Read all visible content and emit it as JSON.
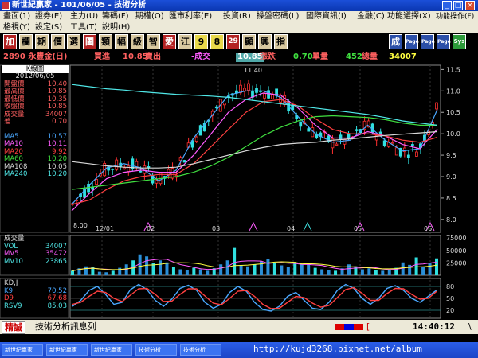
{
  "window": {
    "title": "新世紀贏家 - 101/06/05 - 技術分析"
  },
  "menu": {
    "row1": [
      "畫面(1)",
      "證券(E)",
      "主力(U)",
      "籌碼(F)",
      "期權(O)",
      "匯市利率(E)",
      "投資(R)",
      "操盤密碼(L)",
      "國際資訊(I)",
      "金融(C)",
      "功能選擇(X)",
      "功能操作(F)"
    ],
    "row2": [
      "格視(Y)",
      "設定(S)",
      "工具(T)",
      "說明(H)"
    ]
  },
  "toolbar": {
    "buttons": [
      "加",
      "欄",
      "期",
      "價",
      "選",
      "圖",
      "類",
      "幅",
      "級",
      "智",
      "愛",
      "江",
      "9",
      "8",
      "29",
      "顯",
      "興",
      "指"
    ],
    "right_buttons": [
      "成",
      "Page",
      "Page",
      "Page",
      "Sys"
    ]
  },
  "quote": {
    "stock": "2890 永豐金(日)",
    "bid_label": "買進",
    "bid": "10.85",
    "ask_label": "賣出",
    "ask": "-成交",
    "last": "10.85",
    "change_label": "漲跌",
    "change": "0.70",
    "unit_label": "單量",
    "unit": "452",
    "vol_label": "總量",
    "vol": "34007"
  },
  "price_panel": {
    "title": "K線圖",
    "date": "2012/06/05",
    "rows": [
      {
        "k": "開盤價",
        "v": "10.40",
        "color": "#ff6060"
      },
      {
        "k": "最高價",
        "v": "10.85",
        "color": "#ff6060"
      },
      {
        "k": "最低價",
        "v": "10.35",
        "color": "#ff6060"
      },
      {
        "k": "收盤價",
        "v": "10.85",
        "color": "#ff6060"
      },
      {
        "k": "成交量",
        "v": "34007",
        "color": "#ff6060"
      },
      {
        "k": "差",
        "v": "0.70",
        "color": "#ff6060"
      }
    ],
    "ma_rows": [
      {
        "k": "MA5",
        "v": "10.57",
        "color": "#4aa8ff"
      },
      {
        "k": "MA10",
        "v": "10.11",
        "color": "#ff5cff"
      },
      {
        "k": "MA20",
        "v": "9.92",
        "color": "#ff4040"
      },
      {
        "k": "MA60",
        "v": "10.20",
        "color": "#40e040"
      },
      {
        "k": "MA108",
        "v": "10.05",
        "color": "#d8d8d8"
      },
      {
        "k": "MA240",
        "v": "10.20",
        "color": "#50e8e8"
      }
    ]
  },
  "volume_panel": {
    "title": "成交量",
    "rows": [
      {
        "k": "VOL",
        "v": "34007",
        "color": "#50e8e8"
      },
      {
        "k": "MV5",
        "v": "35472",
        "color": "#ff5cff"
      },
      {
        "k": "MV10",
        "v": "23865",
        "color": "#50e8e8"
      }
    ]
  },
  "kd_panel": {
    "title": "KD,J",
    "rows": [
      {
        "k": "K9",
        "v": "70.52",
        "color": "#4aa8ff"
      },
      {
        "k": "D9",
        "v": "67.68",
        "color": "#ff4040"
      },
      {
        "k": "RSV9",
        "v": "85.03",
        "color": "#50e8e8"
      }
    ]
  },
  "chart_data": [
    {
      "type": "candlestick",
      "title": "K線圖",
      "ylim": [
        7.7,
        11.6
      ],
      "y_ticks": [
        "11.5",
        "11.0",
        "10.5",
        "10.0",
        "9.5",
        "9.0",
        "8.5",
        "8.0"
      ],
      "x_ticks": [
        "12/01",
        "02",
        "03",
        "04",
        "05",
        "06"
      ],
      "annotations": [
        "11.40",
        "8.00"
      ],
      "series": [
        {
          "name": "MA5",
          "color": "#4aa8ff",
          "values": [
            8.35,
            8.8,
            9.2,
            9.3,
            9.2,
            8.9,
            9.15,
            9.9,
            10.4,
            10.9,
            11.0,
            11.0,
            10.85,
            10.4,
            10.0,
            9.8,
            9.85,
            10.2,
            9.85,
            9.6,
            9.65,
            10.57
          ]
        },
        {
          "name": "MA10",
          "color": "#ff5cff",
          "values": [
            8.2,
            8.6,
            8.95,
            9.1,
            9.15,
            9.1,
            9.1,
            9.5,
            10.0,
            10.5,
            10.8,
            10.95,
            10.9,
            10.6,
            10.2,
            9.9,
            9.9,
            10.05,
            9.95,
            9.75,
            9.65,
            10.11
          ]
        },
        {
          "name": "MA20",
          "color": "#ff4040",
          "values": [
            8.35,
            8.45,
            8.7,
            8.9,
            9.0,
            9.05,
            9.05,
            9.3,
            9.7,
            10.1,
            10.5,
            10.75,
            10.8,
            10.65,
            10.35,
            10.1,
            10.0,
            10.0,
            9.95,
            9.85,
            9.8,
            9.92
          ]
        },
        {
          "name": "MA60",
          "color": "#40e040",
          "values": [
            8.7,
            8.75,
            8.8,
            8.85,
            8.9,
            8.95,
            9.0,
            9.1,
            9.25,
            9.45,
            9.7,
            9.95,
            10.15,
            10.3,
            10.4,
            10.42,
            10.4,
            10.38,
            10.33,
            10.25,
            10.2,
            10.2
          ]
        },
        {
          "name": "MA108",
          "color": "#d8d8d8",
          "values": [
            9.35,
            9.3,
            9.25,
            9.22,
            9.2,
            9.2,
            9.22,
            9.3,
            9.4,
            9.5,
            9.6,
            9.68,
            9.75,
            9.78,
            9.8,
            9.85,
            9.88,
            9.92,
            9.96,
            9.99,
            10.02,
            10.05
          ]
        },
        {
          "name": "MA240",
          "color": "#50e8e8",
          "values": [
            11.15,
            11.1,
            11.05,
            11.02,
            10.98,
            10.95,
            10.92,
            10.9,
            10.88,
            10.85,
            10.8,
            10.75,
            10.7,
            10.65,
            10.6,
            10.55,
            10.5,
            10.45,
            10.38,
            10.3,
            10.25,
            10.2
          ]
        }
      ]
    },
    {
      "type": "bar",
      "title": "成交量",
      "ylim": [
        0,
        80000
      ],
      "y_ticks": [
        "75000",
        "50000",
        "25000"
      ],
      "values": [
        9000,
        14000,
        18000,
        16000,
        7000,
        6000,
        9000,
        15000,
        22000,
        30000,
        42000,
        38000,
        24000,
        30000,
        26000,
        16000,
        12000,
        11000,
        15000,
        12000,
        9000,
        14000,
        22000,
        30000,
        55000,
        20000,
        18000,
        22000,
        28000,
        32000,
        25000,
        20000,
        17000,
        26000,
        22000,
        24000,
        15000,
        12000,
        10000,
        9000,
        14000,
        22000,
        18000,
        12000,
        14000,
        10000,
        9000,
        12000,
        15000,
        26000,
        21000,
        36000,
        16000,
        25000,
        34007
      ]
    },
    {
      "type": "line",
      "title": "KD,J",
      "ylim": [
        0,
        100
      ],
      "y_ticks": [
        "80",
        "50",
        "20"
      ],
      "series": [
        {
          "name": "K9",
          "color": "#4aa8ff",
          "values": [
            30,
            45,
            70,
            80,
            60,
            35,
            40,
            72,
            85,
            72,
            45,
            30,
            48,
            75,
            83,
            70,
            40,
            25,
            35,
            65,
            80,
            68,
            40,
            22,
            18,
            30,
            55,
            65,
            45,
            25,
            22,
            40,
            70,
            85,
            75,
            50,
            35,
            50,
            75,
            82,
            70,
            50,
            40,
            55,
            70.52
          ]
        },
        {
          "name": "D9",
          "color": "#ff4040",
          "values": [
            35,
            40,
            55,
            68,
            65,
            50,
            42,
            58,
            74,
            75,
            60,
            42,
            43,
            60,
            74,
            74,
            56,
            38,
            34,
            50,
            68,
            70,
            55,
            35,
            24,
            25,
            40,
            55,
            52,
            38,
            28,
            32,
            52,
            72,
            77,
            63,
            45,
            45,
            62,
            75,
            74,
            60,
            48,
            50,
            67.68
          ]
        }
      ]
    }
  ],
  "status": {
    "badge": "精誠",
    "message": "技術分析訊息列",
    "bracket": "[",
    "time": "14:40:12",
    "end_bracket": "\\"
  },
  "taskbar": {
    "items": [
      "新世紀贏家",
      "新世紀贏家",
      "新世紀贏家",
      "技術分析",
      "技術分析"
    ],
    "url": "http://kujd3268.pixnet.net/album"
  }
}
